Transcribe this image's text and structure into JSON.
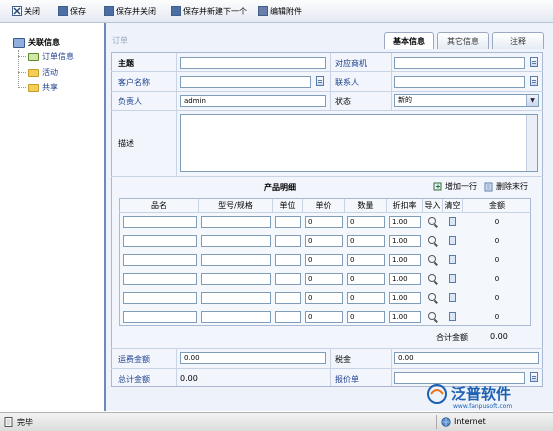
{
  "toolbar": {
    "close": "关闭",
    "save": "保存",
    "save_close": "保存并关闭",
    "save_new": "保存并新建下一个",
    "edit_attach": "编辑附件"
  },
  "tree": {
    "root": "关联信息",
    "items": [
      "订单信息",
      "活动",
      "共享"
    ]
  },
  "tabs": [
    "基本信息",
    "其它信息",
    "注释"
  ],
  "form": {
    "section_title": "订单",
    "subject_label": "主题",
    "opportunity_label": "对应商机",
    "customer_label": "客户名称",
    "contact_label": "联系人",
    "owner_label": "负责人",
    "owner_value": "admin",
    "status_label": "状态",
    "status_value": "新的",
    "desc_label": "描述"
  },
  "products": {
    "title": "产品明细",
    "add_row": "增加一行",
    "del_row": "删除末行",
    "headers": [
      "品名",
      "型号/规格",
      "单位",
      "单价",
      "数量",
      "折扣率",
      "导入",
      "清空",
      "金额"
    ],
    "rows": [
      {
        "price": "0",
        "qty": "0",
        "discount": "1.00",
        "amount": "0"
      },
      {
        "price": "0",
        "qty": "0",
        "discount": "1.00",
        "amount": "0"
      },
      {
        "price": "0",
        "qty": "0",
        "discount": "1.00",
        "amount": "0"
      },
      {
        "price": "0",
        "qty": "0",
        "discount": "1.00",
        "amount": "0"
      },
      {
        "price": "0",
        "qty": "0",
        "discount": "1.00",
        "amount": "0"
      },
      {
        "price": "0",
        "qty": "0",
        "discount": "1.00",
        "amount": "0"
      }
    ],
    "total_label": "合计金额",
    "total_value": "0.00"
  },
  "footer": {
    "freight_label": "运费金额",
    "freight_value": "0.00",
    "tax_label": "税金",
    "tax_value": "0.00",
    "grand_label": "总计金额",
    "grand_value": "0.00",
    "quote_label": "报价单"
  },
  "status": {
    "left": "完毕",
    "zone": "Internet"
  },
  "brand": {
    "name": "泛普软件",
    "url": "www.fanpusoft.com"
  }
}
